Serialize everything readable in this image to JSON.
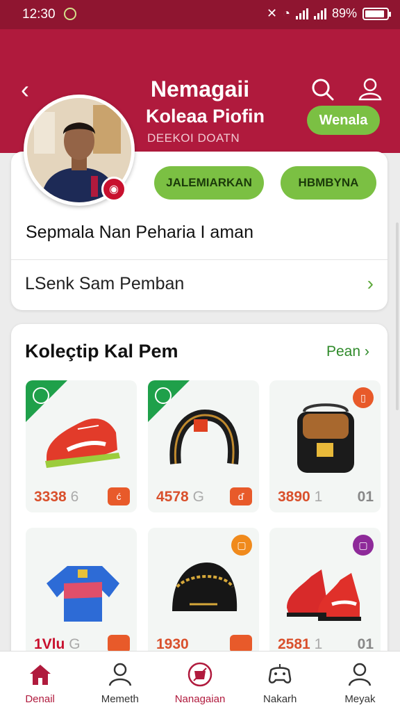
{
  "status": {
    "time": "12:30",
    "battery": "89%",
    "battery_level": 0.89
  },
  "header": {
    "title": "Nemagaii"
  },
  "profile": {
    "name": "Koleaa Piofin",
    "subtitle": "DEEKOI DOATN",
    "follow_label": "Wenala",
    "action_a_label": "JALEMIARKAN",
    "action_b_label": "HBMBYNA"
  },
  "info": {
    "title": "Sepmala Nan Peharia I aman",
    "link_label": "LSenk Sam Pemban"
  },
  "collection": {
    "title": "Koleçtip Kal Pem",
    "more_label": "Pean",
    "products": [
      {
        "name": "red sneaker",
        "price": "3338",
        "suffix": "6",
        "tag": "ć",
        "accent": "#1fa04a"
      },
      {
        "name": "black headband",
        "price": "4578",
        "suffix": "G",
        "tag": "ď",
        "accent": "#1fa04a"
      },
      {
        "name": "black bag",
        "price": "3890",
        "suffix": "1",
        "code": "01",
        "accent": "#e85a2a"
      },
      {
        "name": "blue jersey",
        "price": "1Vlu",
        "suffix": "G",
        "accent": "#e85a2a"
      },
      {
        "name": "black cap",
        "price": "1930",
        "suffix": "",
        "accent": "#f08a1c"
      },
      {
        "name": "red boots",
        "price": "2581",
        "suffix": "1",
        "code": "01",
        "accent": "#8e2a99"
      }
    ]
  },
  "nav": [
    {
      "label": "Denail",
      "icon": "home-icon"
    },
    {
      "label": "Memeth",
      "icon": "person-icon"
    },
    {
      "label": "Nanagaian",
      "icon": "shop-icon"
    },
    {
      "label": "Nakarh",
      "icon": "gamepad-icon"
    },
    {
      "label": "Meyak",
      "icon": "profile-icon"
    }
  ],
  "colors": {
    "brand": "#b01a3d",
    "accent_green": "#7bc043",
    "price_orange": "#d9502c"
  }
}
